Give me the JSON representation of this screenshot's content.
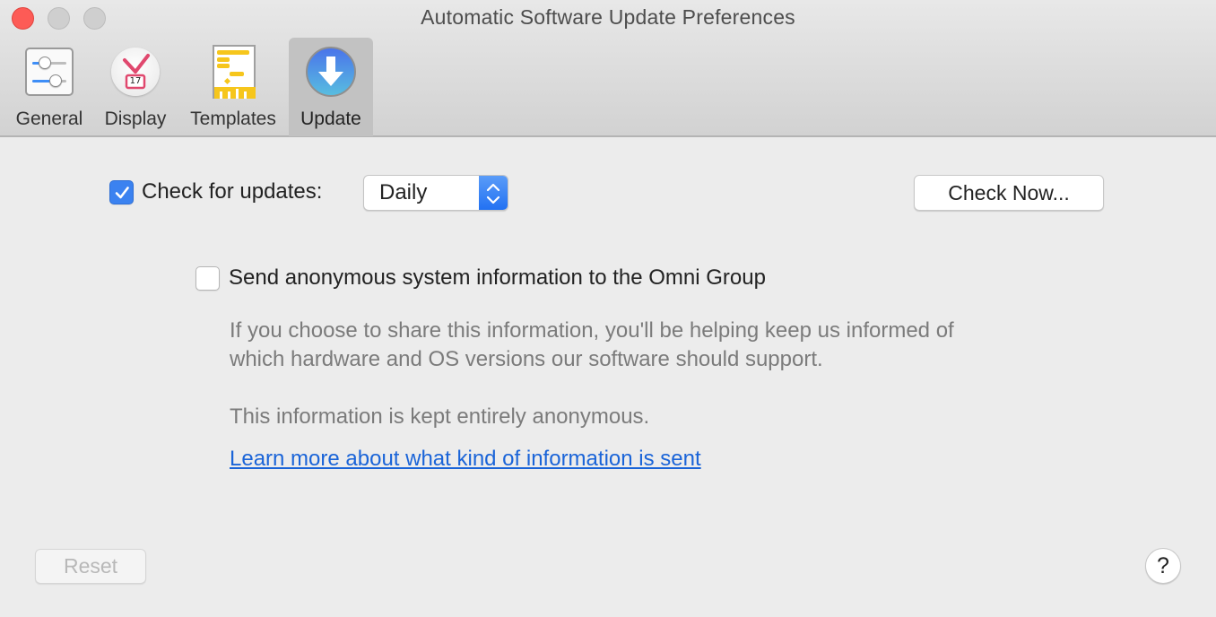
{
  "window": {
    "title": "Automatic Software Update Preferences",
    "controls": [
      "close",
      "minimize",
      "zoom"
    ]
  },
  "toolbar": {
    "tabs": [
      {
        "label": "General",
        "icon": "sliders-icon",
        "selected": false
      },
      {
        "label": "Display",
        "icon": "clock-calendar-icon",
        "selected": false,
        "icon_badge": "17"
      },
      {
        "label": "Templates",
        "icon": "gantt-template-icon",
        "selected": false
      },
      {
        "label": "Update",
        "icon": "download-arrow-icon",
        "selected": true
      }
    ]
  },
  "updates": {
    "check_label": "Check for updates:",
    "check_enabled": true,
    "frequency_value": "Daily",
    "check_now_label": "Check Now..."
  },
  "anonymous": {
    "label": "Send anonymous system information to the Omni Group",
    "enabled": false,
    "description_line1": "If you choose to share this information, you'll be helping keep us informed of",
    "description_line2": "which hardware and OS versions our software should support.",
    "note": "This information is kept entirely anonymous.",
    "learn_more_link": "Learn more about what kind of information is sent"
  },
  "footer": {
    "reset_label": "Reset",
    "reset_enabled": false,
    "help_label": "?"
  },
  "colors": {
    "accent": "#3b82f0",
    "link": "#1a64d8",
    "close": "#fd5b56"
  }
}
